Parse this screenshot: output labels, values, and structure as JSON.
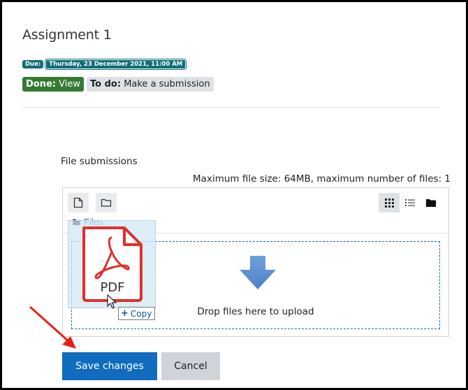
{
  "assignment": {
    "title": "Assignment 1",
    "due_label": "Due:",
    "due_date": "Thursday, 23 December 2021, 11:00 AM",
    "done_label": "Done:",
    "done_value": "View",
    "todo_label": "To do:",
    "todo_value": "Make a submission"
  },
  "file_submissions": {
    "label": "File submissions",
    "max_info": "Maximum file size: 64MB, maximum number of files: 1",
    "path_label": "Files",
    "drop_text": "Drop files here to upload"
  },
  "drag_ghost": {
    "file_type": "PDF",
    "copy_tooltip": "Copy"
  },
  "buttons": {
    "save": "Save changes",
    "cancel": "Cancel"
  },
  "colors": {
    "primary": "#0f6cbf",
    "due_badge": "#0f6e78",
    "done_badge": "#357a32",
    "pdf_red": "#e0302b",
    "annotation_arrow": "#e8201a"
  }
}
